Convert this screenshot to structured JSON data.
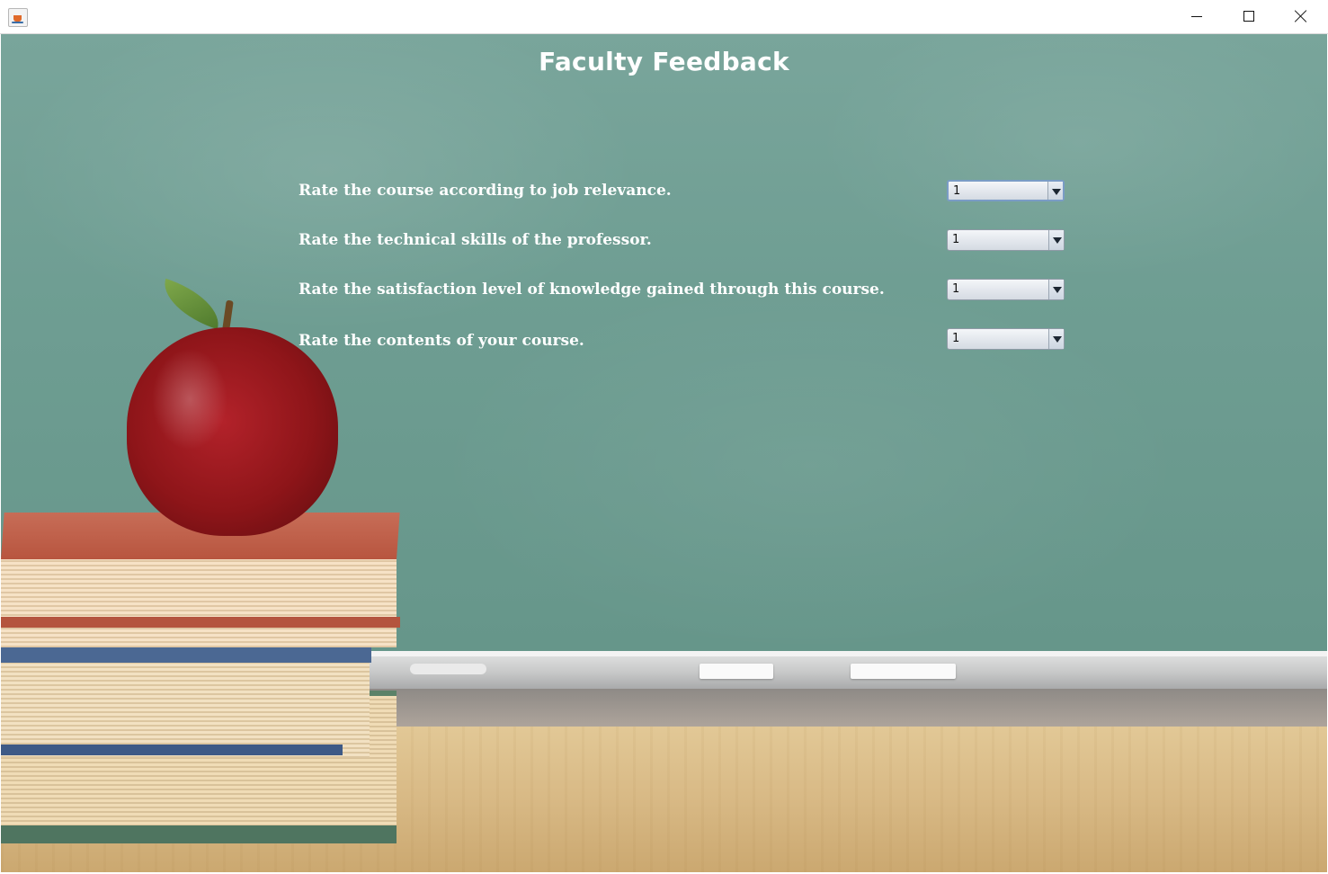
{
  "window": {
    "title": "",
    "icon": "java-cup-icon",
    "controls": [
      "minimize",
      "maximize",
      "close"
    ]
  },
  "page": {
    "title": "Faculty Feedback"
  },
  "questions": [
    {
      "label": "Rate the course according to job relevance.",
      "selected": "1"
    },
    {
      "label": "Rate the technical skills of the professor.",
      "selected": "1"
    },
    {
      "label": "Rate the satisfaction level of knowledge gained through this course.",
      "selected": "1"
    },
    {
      "label": "Rate the contents of your course.",
      "selected": "1"
    }
  ],
  "colors": {
    "chalkboard": "#6f9e93",
    "text": "#ffffff",
    "apple": "#a01c22"
  }
}
